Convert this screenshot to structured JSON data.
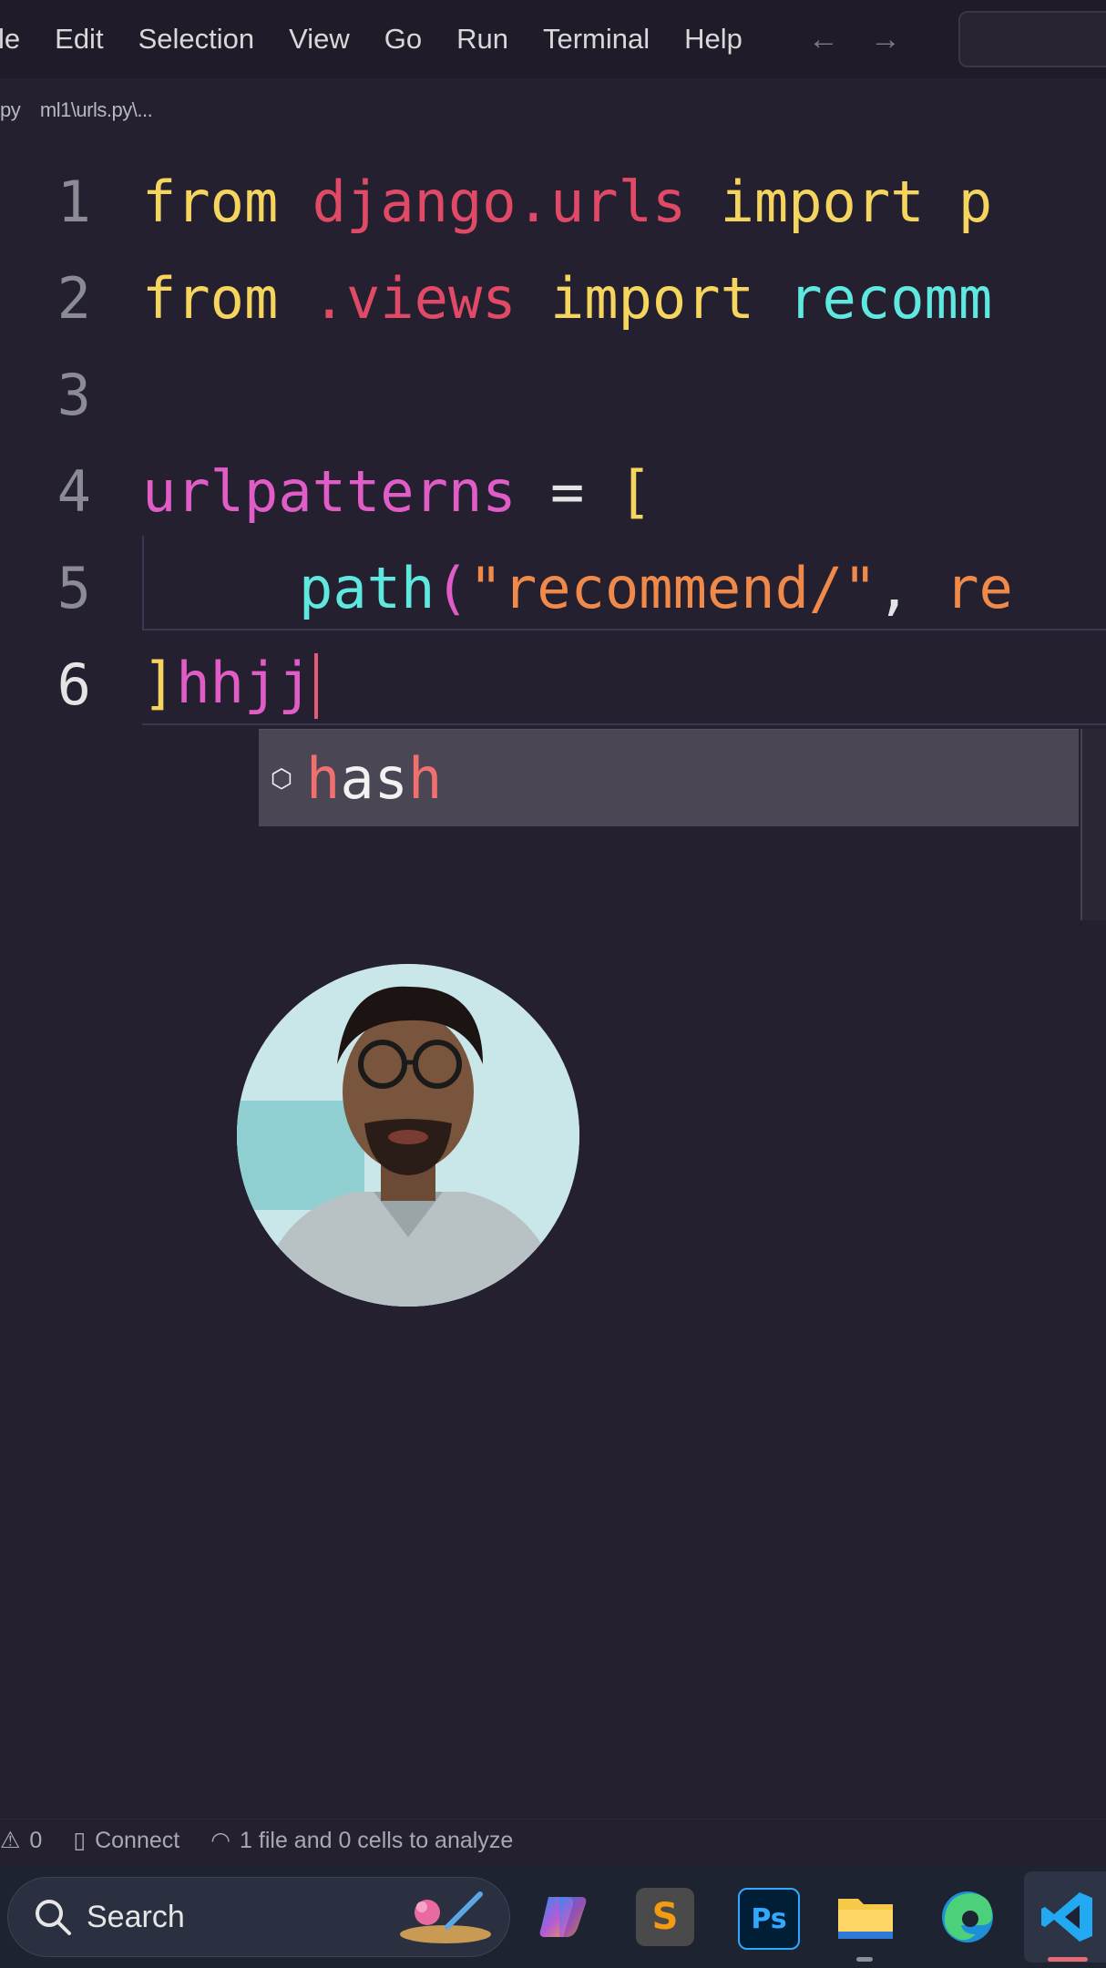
{
  "menubar": {
    "items": [
      "le",
      "Edit",
      "Selection",
      "View",
      "Go",
      "Run",
      "Terminal",
      "Help"
    ],
    "back_arrow": "←",
    "forward_arrow": "→"
  },
  "breadcrumb": {
    "file_suffix": "py",
    "path": "ml1\\urls.py\\..."
  },
  "editor": {
    "lines": [
      {
        "number": "1"
      },
      {
        "number": "2"
      },
      {
        "number": "3"
      },
      {
        "number": "4"
      },
      {
        "number": "5"
      },
      {
        "number": "6"
      }
    ],
    "l1": {
      "kw1": "from",
      "mod": "django",
      "dot": ".",
      "mod2": "urls",
      "kw2": "import",
      "tail": "p"
    },
    "l2": {
      "kw1": "from",
      "dot": ".",
      "mod": "views",
      "kw2": "import",
      "tail": "recomm"
    },
    "l4": {
      "var": "urlpatterns",
      "eq": "=",
      "brk": "["
    },
    "l5": {
      "fn": "path",
      "paren": "(",
      "str": "\"recommend/\"",
      "comma": ",",
      "tail": "re"
    },
    "l6": {
      "brk": "]",
      "typed": "hhjj"
    }
  },
  "suggest": {
    "icon": "⬡",
    "match": "h",
    "rest_mid": "as",
    "match2": "h"
  },
  "status": {
    "warnings_icon": "⚠",
    "warnings": "0",
    "connect_icon": "▯",
    "connect": "Connect",
    "analyze_icon": "◠",
    "analyze": "1 file and 0 cells to analyze"
  },
  "taskbar": {
    "search_label": "Search",
    "apps": [
      {
        "name": "copilot",
        "glyph": "◆",
        "color": "#7b6cf0"
      },
      {
        "name": "sublime",
        "glyph": "S",
        "color": "#f39c12"
      },
      {
        "name": "photoshop",
        "glyph": "Ps",
        "color": "#31a8ff"
      },
      {
        "name": "file-explorer",
        "glyph": "▬",
        "color": "#f7c948"
      },
      {
        "name": "edge",
        "glyph": "◉",
        "color": "#2fb6e6"
      },
      {
        "name": "vscode",
        "glyph": "❯",
        "color": "#23a9f2"
      }
    ]
  }
}
